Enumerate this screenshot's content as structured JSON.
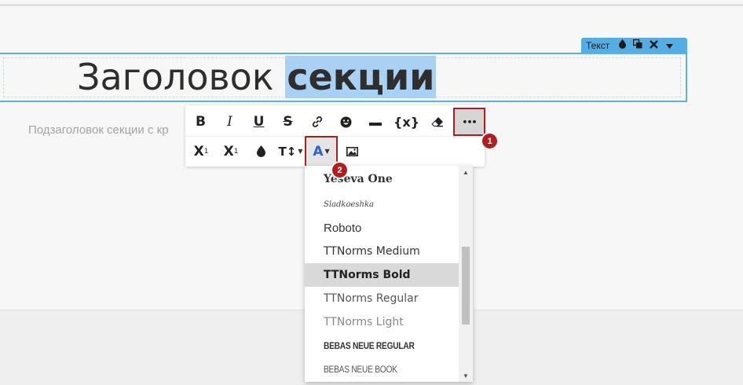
{
  "block_toolbar": {
    "label": "Текст",
    "icons": [
      "drop-icon",
      "duplicate-icon",
      "close-icon",
      "caret-down-icon"
    ]
  },
  "heading": {
    "part1": "Заголовок ",
    "selected": "секции"
  },
  "subheading": "Подзаголовок секции с кр",
  "toolbar": {
    "row1": {
      "bold": "B",
      "italic": "I",
      "underline": "U",
      "strike": "S",
      "link": "link-icon",
      "emoji": "smile-icon",
      "hr": "horizontal-line-icon",
      "variable": "{x}",
      "eraser": "eraser-icon",
      "more": "•••"
    },
    "row2": {
      "subscript": "X",
      "subscript_mark": "1",
      "superscript": "X",
      "superscript_mark": "1",
      "color": "drop-icon",
      "font_size": "T↕",
      "font_family": "A",
      "image": "image-icon"
    }
  },
  "callouts": {
    "one": "1",
    "two": "2"
  },
  "fonts": {
    "items": [
      "Yeseva One",
      "Sladkoeshka",
      "Roboto",
      "TTNorms Medium",
      "TTNorms Bold",
      "TTNorms Regular",
      "TTNorms Light",
      "Bebas Neue Regular",
      "Bebas Neue Book"
    ],
    "highlighted": "TTNorms Bold"
  },
  "colors": {
    "accent_blue": "#58b2e3",
    "selection": "#a9d1f3",
    "callout_red": "#b21e1e",
    "font_button_blue": "#2a62d4"
  }
}
